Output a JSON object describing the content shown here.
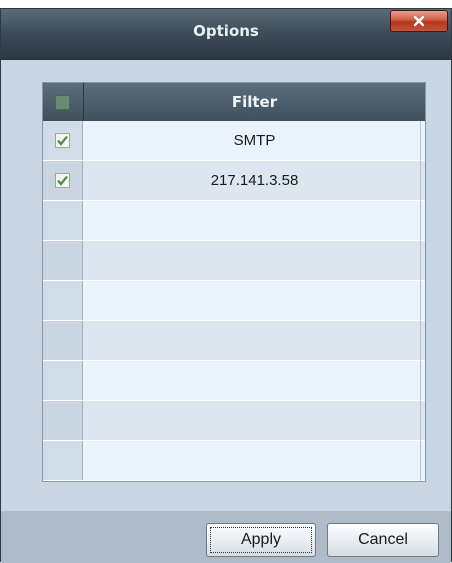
{
  "window": {
    "title": "Options",
    "close_glyph": "x"
  },
  "grid": {
    "header": {
      "label": "Filter"
    },
    "rows": [
      {
        "checked": true,
        "value": "SMTP"
      },
      {
        "checked": true,
        "value": "217.141.3.58"
      },
      {
        "checked": false,
        "value": ""
      },
      {
        "checked": false,
        "value": ""
      },
      {
        "checked": false,
        "value": ""
      },
      {
        "checked": false,
        "value": ""
      },
      {
        "checked": false,
        "value": ""
      },
      {
        "checked": false,
        "value": ""
      },
      {
        "checked": false,
        "value": ""
      }
    ]
  },
  "footer": {
    "apply_label": "Apply",
    "cancel_label": "Cancel"
  },
  "icons": {
    "close": "close-icon",
    "check": "check-icon"
  },
  "colors": {
    "titlebar": "#3e4d5b",
    "close_button": "#c6533a",
    "header": "#4a5b69",
    "check": "#4a8a3a"
  }
}
